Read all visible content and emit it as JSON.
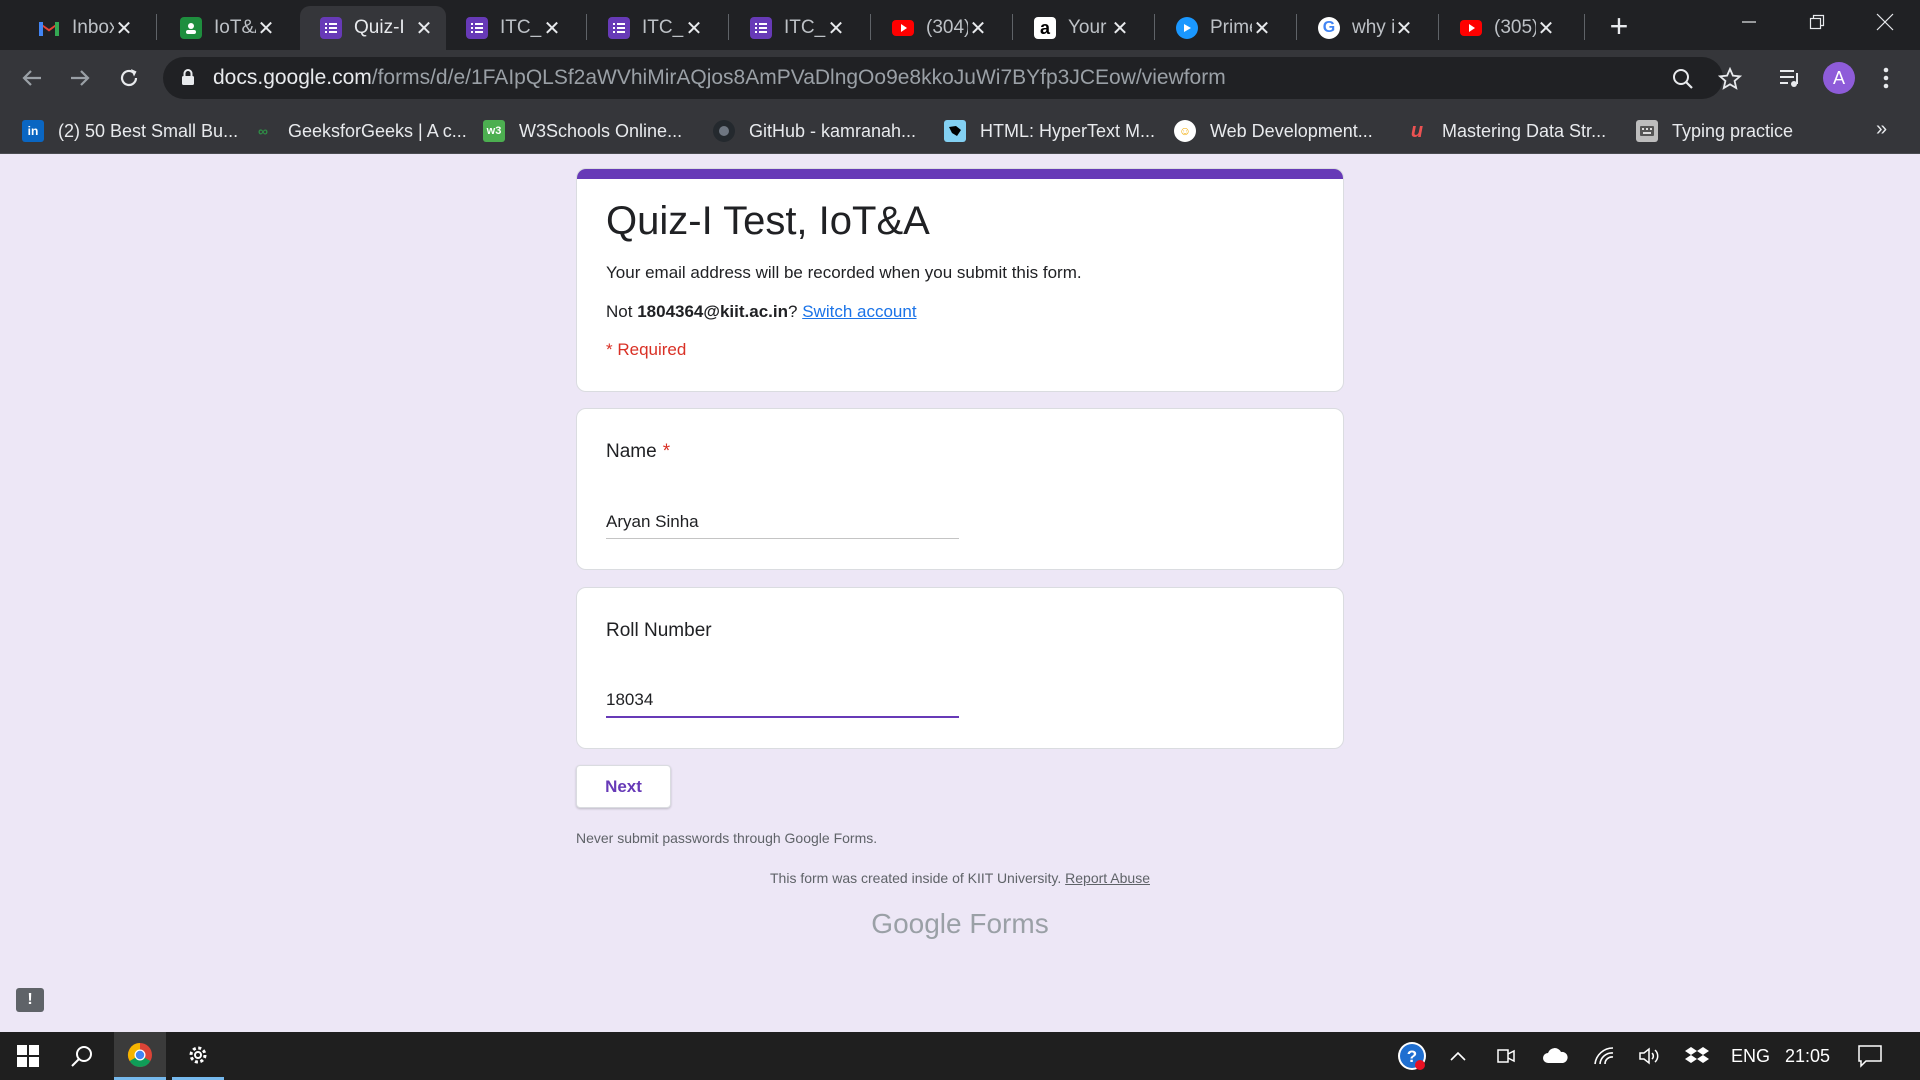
{
  "browser": {
    "tabs": [
      {
        "title": "Inbox",
        "icon": "gmail-icon",
        "color": "#ea4335"
      },
      {
        "title": "IoT&A",
        "icon": "google-classroom-icon",
        "color": "#1e8e3e"
      },
      {
        "title": "Quiz-I",
        "icon": "google-forms-icon",
        "color": "#673ab7",
        "active": true
      },
      {
        "title": "ITC_Q",
        "icon": "google-forms-icon",
        "color": "#673ab7"
      },
      {
        "title": "ITC_Q",
        "icon": "google-forms-icon",
        "color": "#673ab7"
      },
      {
        "title": "ITC_Q",
        "icon": "google-forms-icon",
        "color": "#673ab7"
      },
      {
        "title": "(304)",
        "icon": "youtube-icon",
        "color": "#ff0000"
      },
      {
        "title": "Your",
        "icon": "amazon-icon",
        "color": "#ffffff"
      },
      {
        "title": "Prime",
        "icon": "prime-video-icon",
        "color": "#1a98ff"
      },
      {
        "title": "why is",
        "icon": "google-icon",
        "color": "#4285f4"
      },
      {
        "title": "(305)",
        "icon": "youtube-icon",
        "color": "#ff0000"
      }
    ],
    "url_host": "docs.google.com",
    "url_path": "/forms/d/e/1FAIpQLSf2aWVhiMirAQjos8AmPVaDlngOo9e8kkoJuWi7BYfp3JCEow/viewform",
    "profile_initial": "A",
    "bookmarks": [
      {
        "label": "(2) 50 Best Small Bu...",
        "icon": "linkedin-icon",
        "color": "#0a66c2"
      },
      {
        "label": "GeeksforGeeks | A c...",
        "icon": "geeksforgeeks-icon",
        "color": "#2f8d46"
      },
      {
        "label": "W3Schools Online...",
        "icon": "w3schools-icon",
        "color": "#4caf50"
      },
      {
        "label": "GitHub - kamranah...",
        "icon": "github-icon",
        "color": "#24292e"
      },
      {
        "label": "HTML: HyperText M...",
        "icon": "mdn-icon",
        "color": "#83d0f2"
      },
      {
        "label": "Web Development...",
        "icon": "web-dev-icon",
        "color": "#f2c94c"
      },
      {
        "label": "Mastering Data Str...",
        "icon": "udemy-icon",
        "color": "#ec5252"
      },
      {
        "label": "Typing practice",
        "icon": "typing-icon",
        "color": "#bdbdbd"
      }
    ],
    "bookmarks_more": "»"
  },
  "form": {
    "title": "Quiz-I Test, IoT&A",
    "email_note": "Your email address will be recorded when you submit this form.",
    "account_prefix": "Not",
    "account_email": "1804364@kiit.ac.in",
    "account_suffix": "?",
    "switch_account": "Switch account",
    "required_note": "* Required",
    "questions": [
      {
        "label": "Name",
        "required_mark": "*",
        "value": "Aryan Sinha"
      },
      {
        "label": "Roll Number",
        "required_mark": "",
        "value": "18034"
      }
    ],
    "next_label": "Next",
    "password_warning": "Never submit passwords through Google Forms.",
    "created_note": "This form was created inside of KIIT University.",
    "report_abuse": "Report Abuse",
    "logo_google": "Google",
    "logo_forms": "Forms",
    "accent_color": "#673ab7",
    "background_color": "#ede7f6"
  },
  "taskbar": {
    "language": "ENG",
    "time": "21:05"
  }
}
